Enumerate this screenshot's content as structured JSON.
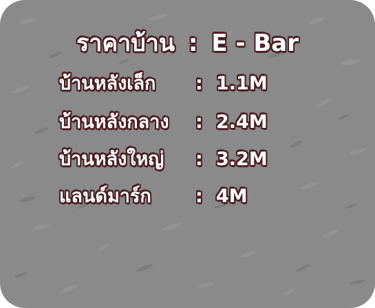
{
  "title": {
    "name": "ราคาบ้าน",
    "separator": ":",
    "server": "E - Bar"
  },
  "rows": [
    {
      "name": "บ้านหลังเล็ก",
      "separator": ":",
      "price": "1.1M"
    },
    {
      "name": "บ้านหลังกลาง",
      "separator": ":",
      "price": "2.4M"
    },
    {
      "name": "บ้านหลังใหญ่",
      "separator": ":",
      "price": "3.2M"
    },
    {
      "name": "แลนด์มาร์ก",
      "separator": ":",
      "price": "4M"
    }
  ],
  "colors": {
    "panel_background": "#8a8a8a",
    "text": "#ffffff",
    "text_outline": "#4a1f24"
  }
}
